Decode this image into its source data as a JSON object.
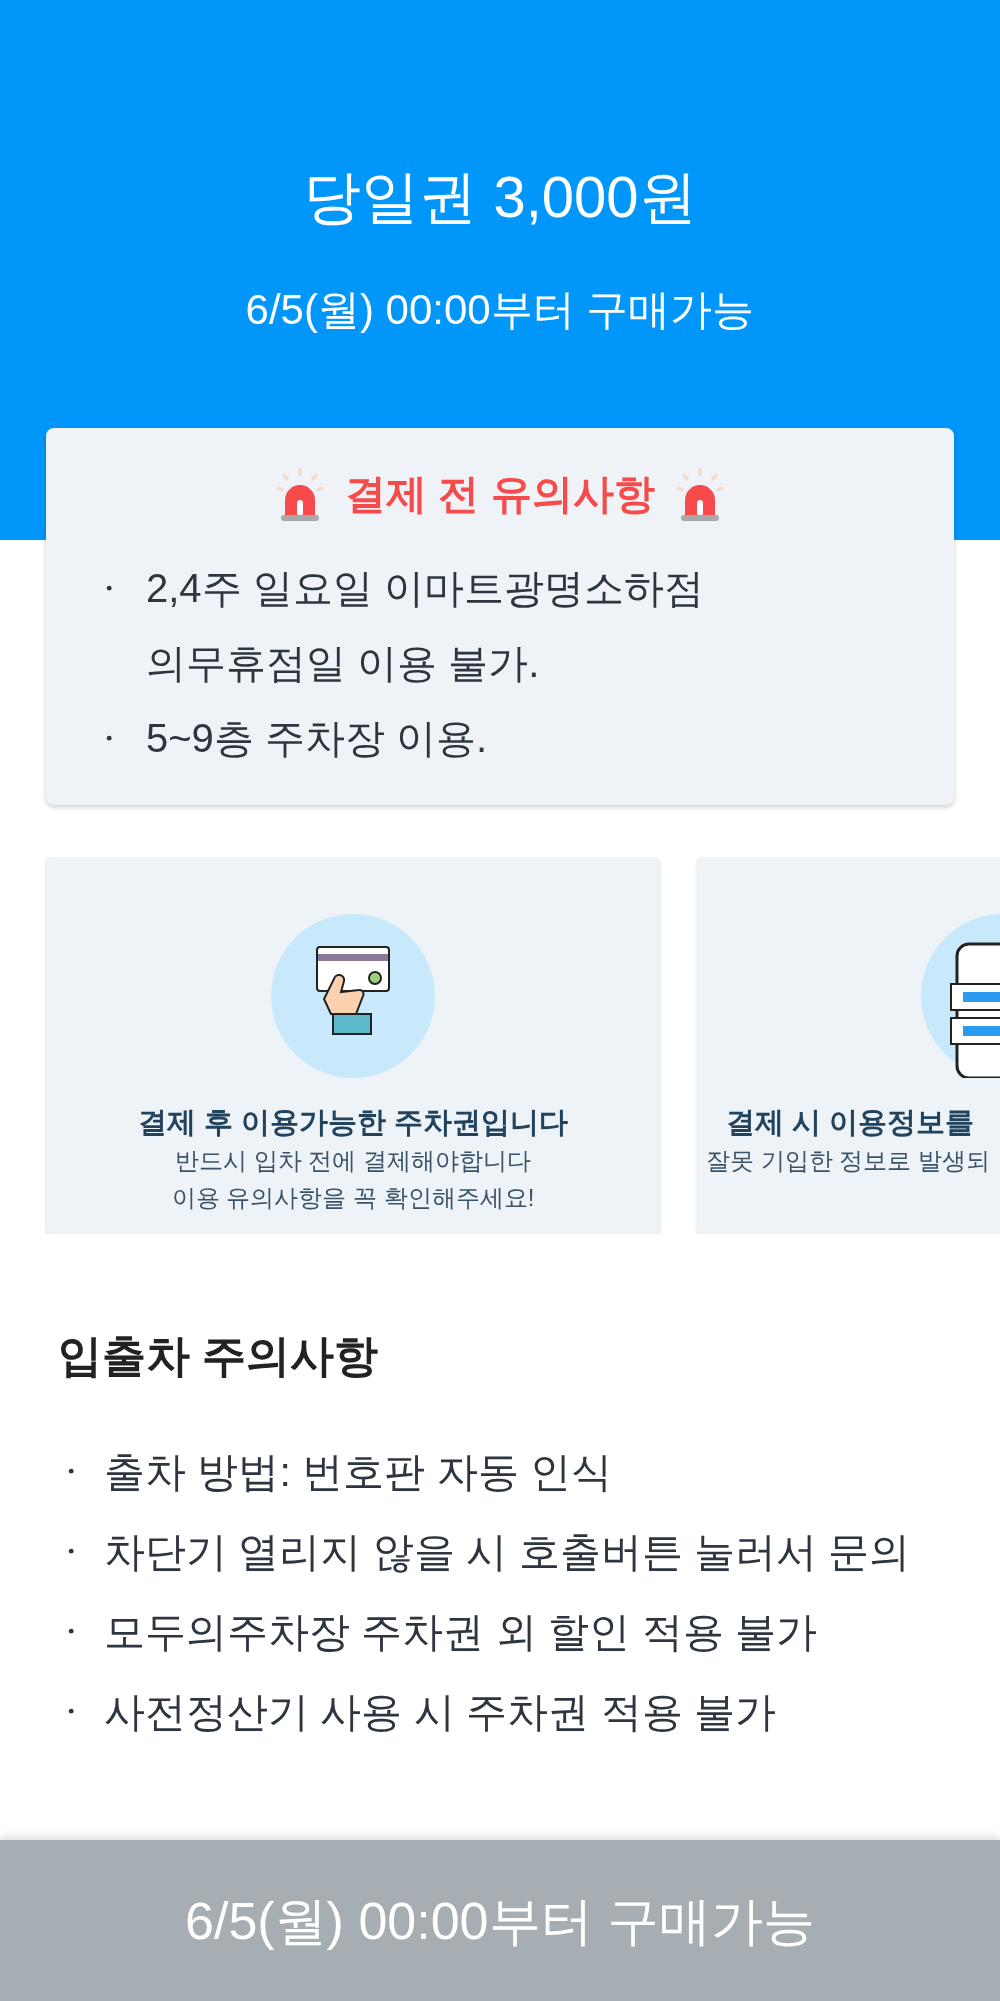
{
  "header": {
    "title": "당일권 3,000원",
    "subtitle": "6/5(월) 00:00부터 구매가능"
  },
  "notice": {
    "title": "결제 전 유의사항",
    "items": [
      {
        "lines": [
          "2,4주 일요일 이마트광명소하점",
          "의무휴점일 이용 불가."
        ]
      },
      {
        "lines": [
          "5~9층 주차장 이용."
        ]
      }
    ]
  },
  "cards": [
    {
      "kind": "card",
      "title": "결제 후 이용가능한 주차권입니다",
      "lines": [
        "반드시 입차 전에 결제해야합니다",
        "이용 유의사항을 꼭 확인해주세요!"
      ]
    },
    {
      "kind": "phone",
      "title": "결제 시 이용정보를",
      "lines": [
        "잘못 기입한 정보로 발생되"
      ]
    }
  ],
  "section": {
    "title": "입출차 주의사항",
    "items": [
      "출차 방법: 번호판 자동 인식",
      "차단기 열리지 않을 시 호출버튼 눌러서 문의",
      "모두의주차장 주차권 외 할인 적용 불가",
      "사전정산기 사용 시 주차권 적용 불가"
    ]
  },
  "buy_button": {
    "label": "6/5(월) 00:00부터 구매가능",
    "disabled": true
  }
}
